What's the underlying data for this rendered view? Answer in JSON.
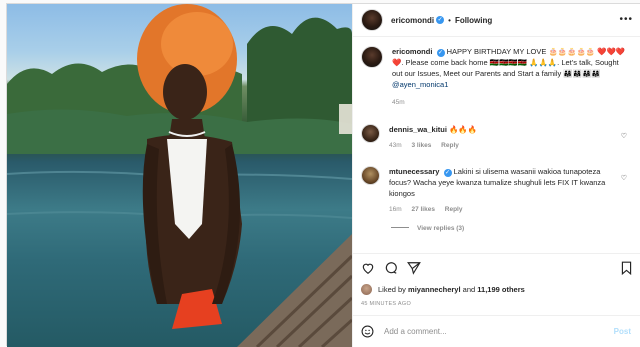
{
  "header": {
    "username": "ericomondi",
    "follow_status": "Following"
  },
  "caption": {
    "username": "ericomondi",
    "text": "HAPPY BIRTHDAY MY LOVE 🎂🎂🎂🎂🎂 ❤️❤️❤️❤️. Please come back home 🇰🇪🇰🇪🇰🇪🇰🇪 🙏🙏🙏. Let’s talk, Sought out our Issues, Meet our Parents and Start a family 👨‍👩‍👧👨‍👩‍👧👨‍👩‍👧👨‍👩‍👧",
    "mention": "@ayen_monica1",
    "time": "45m"
  },
  "comments": [
    {
      "username": "dennis_wa_kitui",
      "text": "🔥🔥🔥",
      "time": "43m",
      "likes": "3 likes",
      "reply": "Reply"
    },
    {
      "username": "mtunecessary",
      "text": "Lakini si ulisema wasanii wakioa tunapoteza focus? Wacha yeye kwanza tumalize shughuli lets FIX IT kwanza kiongos",
      "time": "16m",
      "likes": "27 likes",
      "reply": "Reply"
    }
  ],
  "view_replies": "View replies (3)",
  "liked_by": {
    "prefix": "Liked by",
    "user": "miyannecheryl",
    "and": "and",
    "others": "11,199 others"
  },
  "time_ago": "45 MINUTES AGO",
  "add_comment": {
    "placeholder": "Add a comment...",
    "post_label": "Post"
  },
  "icons": {
    "more": "more-horiz-icon",
    "verified": "verified-badge-icon",
    "heart": "heart-icon",
    "comment": "comment-icon",
    "share": "share-icon",
    "save": "bookmark-icon",
    "emoji": "emoji-icon"
  },
  "colors": {
    "verified_blue": "#3897f0",
    "post_button_disabled": "#b2dffc",
    "mention": "#00376b",
    "secondary_text": "#8e8e8e"
  }
}
